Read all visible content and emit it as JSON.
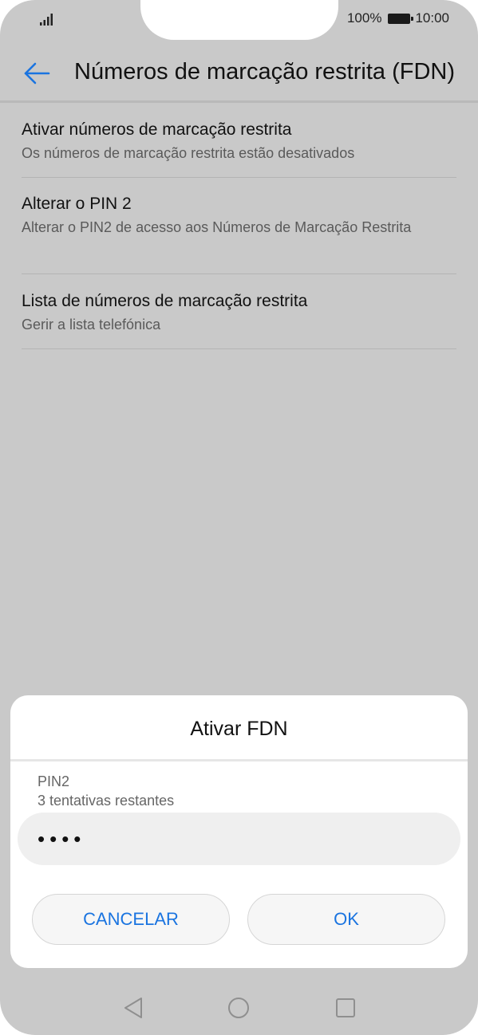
{
  "status_bar": {
    "battery_percent": "100%",
    "time": "10:00",
    "signal_icon": "signal-bars-icon",
    "battery_icon": "battery-full-icon"
  },
  "toolbar": {
    "back_icon": "arrow-left-icon",
    "title": "Números de marcação restrita (FDN)",
    "accent_color": "#1a74e0"
  },
  "settings": {
    "items": [
      {
        "title": "Ativar números de marcação restrita",
        "subtitle": "Os números de marcação restrita estão desativados"
      },
      {
        "title": "Alterar o PIN 2",
        "subtitle": "Alterar o PIN2 de acesso aos Números de Marcação Restrita"
      },
      {
        "title": "Lista de números de marcação restrita",
        "subtitle": "Gerir a lista telefónica"
      }
    ]
  },
  "dialog": {
    "title": "Ativar FDN",
    "pin_label": "PIN2",
    "attempts_label": "3 tentativas restantes",
    "pin_value": "••••",
    "cancel_label": "CANCELAR",
    "ok_label": "OK"
  },
  "nav_bar": {
    "back_icon": "triangle-back-icon",
    "home_icon": "circle-home-icon",
    "recent_icon": "square-recent-icon"
  }
}
